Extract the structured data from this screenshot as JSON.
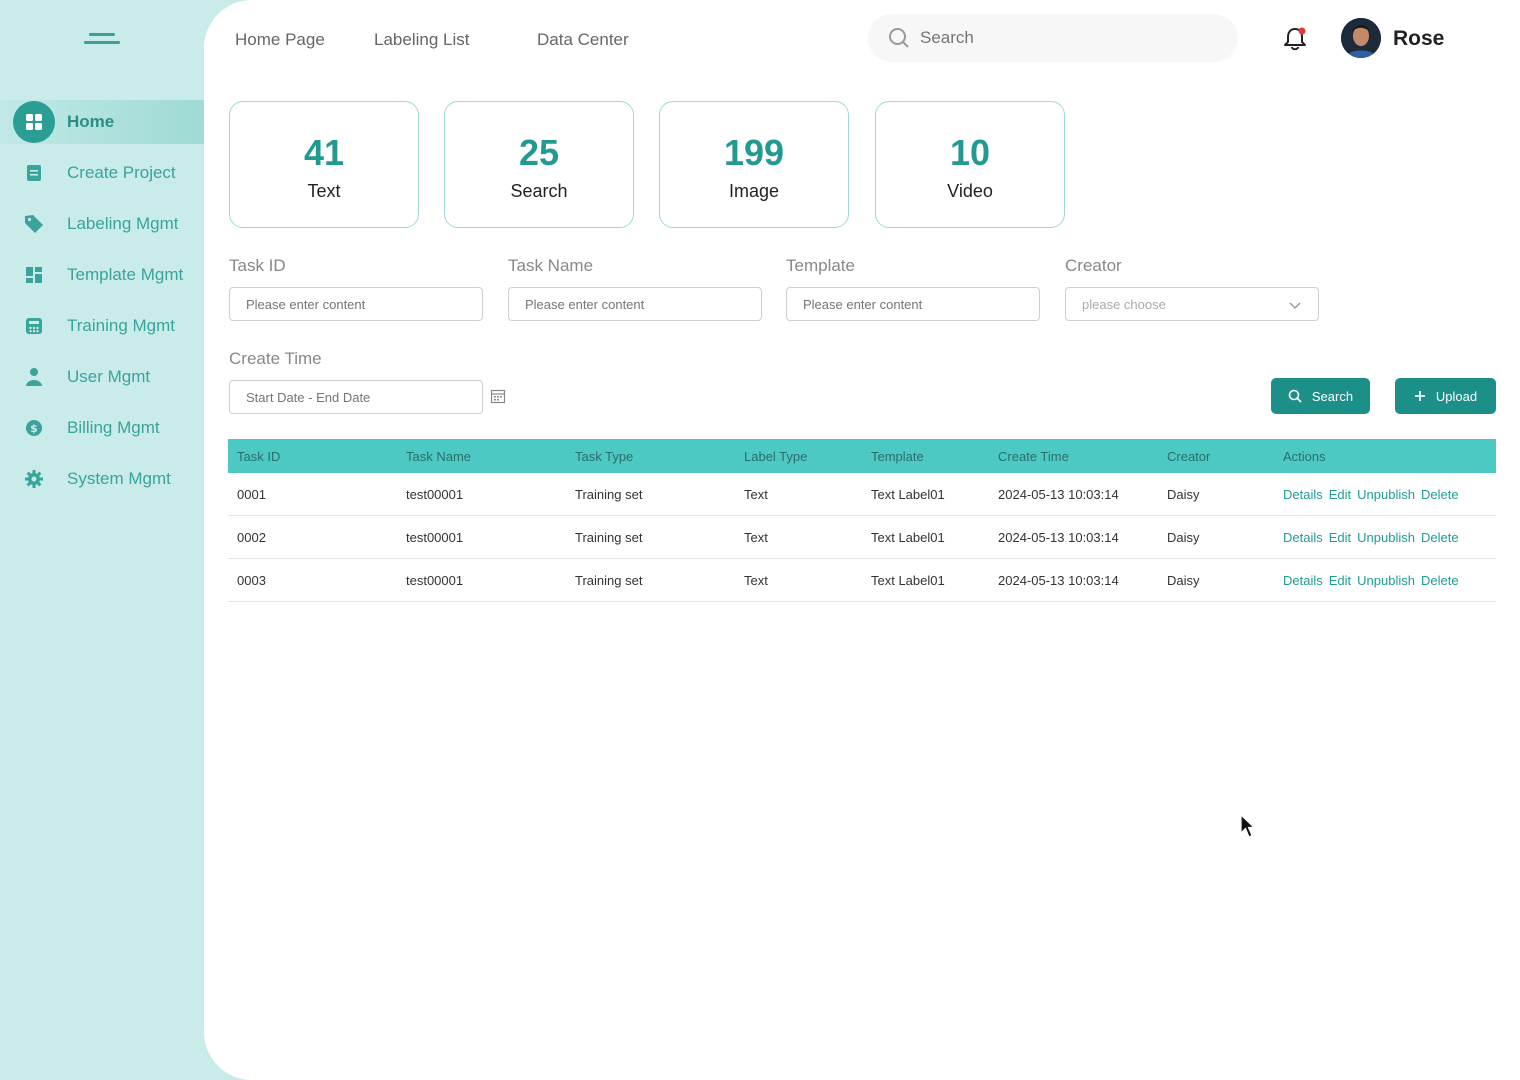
{
  "nav": {
    "top_links": [
      "Home Page",
      "Labeling List",
      "Data Center"
    ],
    "search_placeholder": "Search",
    "user_name": "Rose"
  },
  "sidebar": {
    "items": [
      {
        "label": "Home",
        "icon": "grid-icon",
        "active": true
      },
      {
        "label": "Create Project",
        "icon": "document-icon"
      },
      {
        "label": "Labeling Mgmt",
        "icon": "tag-icon"
      },
      {
        "label": "Template Mgmt",
        "icon": "layout-icon"
      },
      {
        "label": "Training Mgmt",
        "icon": "calculator-icon"
      },
      {
        "label": "User Mgmt",
        "icon": "user-icon"
      },
      {
        "label": "Billing Mgmt",
        "icon": "dollar-icon"
      },
      {
        "label": "System Mgmt",
        "icon": "gear-icon"
      }
    ]
  },
  "stats": [
    {
      "value": "41",
      "label": "Text"
    },
    {
      "value": "25",
      "label": "Search"
    },
    {
      "value": "199",
      "label": "Image"
    },
    {
      "value": "10",
      "label": "Video"
    }
  ],
  "filters": {
    "task_id": {
      "label": "Task ID",
      "placeholder": "Please enter content"
    },
    "task_name": {
      "label": "Task Name",
      "placeholder": "Please enter content"
    },
    "template": {
      "label": "Template",
      "placeholder": "Please enter content"
    },
    "creator": {
      "label": "Creator",
      "placeholder": "please choose"
    },
    "create_time": {
      "label": "Create Time",
      "placeholder": "Start Date - End Date"
    }
  },
  "buttons": {
    "search": "Search",
    "upload": "Upload"
  },
  "table": {
    "headers": [
      "Task ID",
      "Task Name",
      "Task Type",
      "Label Type",
      "Template",
      "Create Time",
      "Creator",
      "Actions"
    ],
    "rows": [
      {
        "id": "0001",
        "name": "test00001",
        "type": "Training set",
        "label_type": "Text",
        "template": "Text Label01",
        "time": "2024-05-13 10:03:14",
        "creator": "Daisy"
      },
      {
        "id": "0002",
        "name": "test00001",
        "type": "Training set",
        "label_type": "Text",
        "template": "Text Label01",
        "time": "2024-05-13 10:03:14",
        "creator": "Daisy"
      },
      {
        "id": "0003",
        "name": "test00001",
        "type": "Training set",
        "label_type": "Text",
        "template": "Text Label01",
        "time": "2024-05-13 10:03:14",
        "creator": "Daisy"
      }
    ],
    "actions": [
      "Details",
      "Edit",
      "Unpublish",
      "Delete"
    ]
  },
  "colors": {
    "accent": "#1c9088",
    "sidebar_bg": "#c9ecea",
    "table_header": "#4cc9c3",
    "notification_dot": "#e53935"
  }
}
